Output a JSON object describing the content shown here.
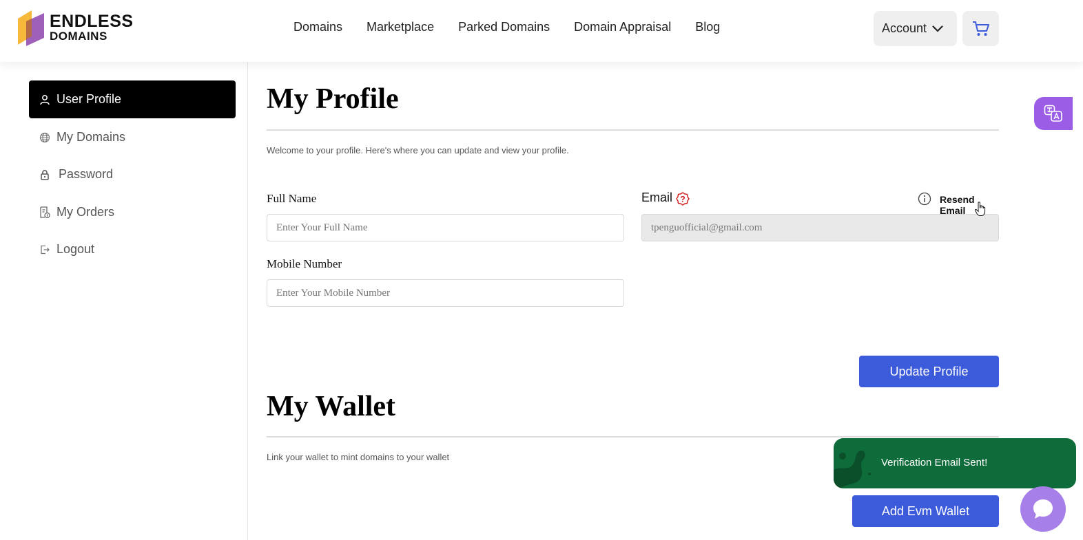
{
  "brand": {
    "line1": "ENDLESS",
    "line2": "DOMAINS"
  },
  "nav": {
    "items": [
      {
        "label": "Domains"
      },
      {
        "label": "Marketplace"
      },
      {
        "label": "Parked Domains"
      },
      {
        "label": "Domain Appraisal"
      },
      {
        "label": "Blog"
      }
    ],
    "account_label": "Account"
  },
  "sidebar": {
    "items": [
      {
        "label": "User Profile",
        "icon": "user-icon"
      },
      {
        "label": "My Domains",
        "icon": "globe-icon"
      },
      {
        "label": "Password",
        "icon": "lock-icon"
      },
      {
        "label": "My Orders",
        "icon": "receipt-icon"
      },
      {
        "label": "Logout",
        "icon": "logout-icon"
      }
    ],
    "active_index": 0
  },
  "profile": {
    "title": "My Profile",
    "subtitle": "Welcome to your profile. Here's where you can update and view your profile.",
    "full_name_label": "Full Name",
    "full_name_placeholder": "Enter Your Full Name",
    "email_label": "Email",
    "email_value": "tpenguofficial@gmail.com",
    "resend_label": "Resend Email",
    "mobile_label": "Mobile Number",
    "mobile_placeholder": "Enter Your Mobile Number",
    "update_button": "Update Profile"
  },
  "wallet": {
    "title": "My Wallet",
    "subtitle": "Link your wallet to mint domains to your wallet",
    "add_button": "Add Evm Wallet"
  },
  "toast": {
    "message": "Verification Email Sent!"
  },
  "colors": {
    "primary": "#3b5bdb",
    "toast_bg": "#0e6b3a",
    "fab_purple": "#9b5de5",
    "error_red": "#d11a1a"
  }
}
